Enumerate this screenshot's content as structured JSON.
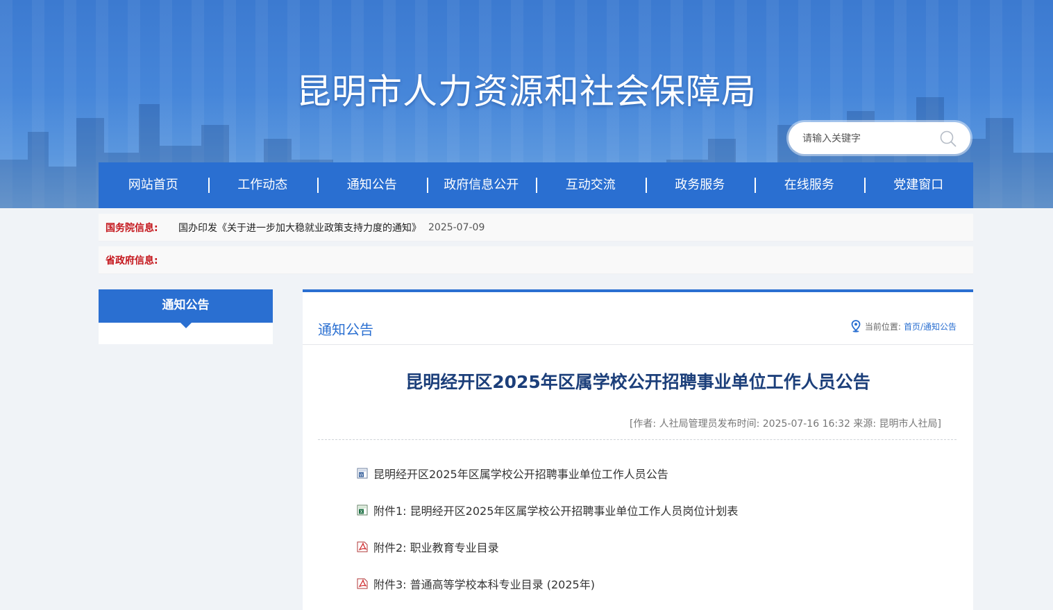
{
  "header": {
    "site_title": "昆明市人力资源和社会保障局",
    "search_placeholder": "请输入关键字"
  },
  "nav": {
    "items": [
      "网站首页",
      "工作动态",
      "通知公告",
      "政府信息公开",
      "互动交流",
      "政务服务",
      "在线服务",
      "党建窗口"
    ]
  },
  "info_bars": [
    {
      "label": "国务院信息:",
      "link": "国办印发《关于进一步加大稳就业政策支持力度的通知》",
      "date": "2025-07-09"
    },
    {
      "label": "省政府信息:",
      "link": "",
      "date": ""
    }
  ],
  "sidebar": {
    "title": "通知公告"
  },
  "main": {
    "section_title": "通知公告",
    "breadcrumb_label": "当前位置:",
    "breadcrumb_path": "首页/通知公告",
    "article_title": "昆明经开区2025年区属学校公开招聘事业单位工作人员公告",
    "meta": "[作者: 人社局管理员发布时间: 2025-07-16 16:32 来源: 昆明市人社局]",
    "attachments": [
      {
        "icon": "word-doc-icon",
        "label": "昆明经开区2025年区属学校公开招聘事业单位工作人员公告"
      },
      {
        "icon": "excel-doc-icon",
        "label": "附件1: 昆明经开区2025年区属学校公开招聘事业单位工作人员岗位计划表"
      },
      {
        "icon": "pdf-doc-icon",
        "label": "附件2: 职业教育专业目录"
      },
      {
        "icon": "pdf-doc-icon",
        "label": "附件3: 普通高等学校本科专业目录 (2025年)"
      }
    ]
  },
  "colors": {
    "brand_blue": "#2a6fd1",
    "title_navy": "#1c3f7a",
    "label_red": "#c4161c"
  }
}
